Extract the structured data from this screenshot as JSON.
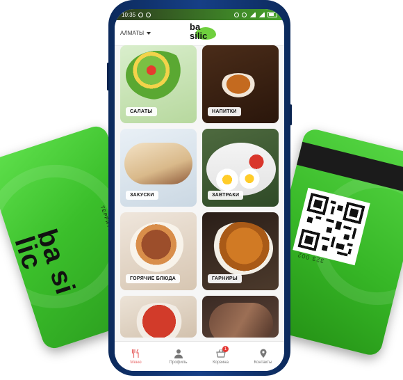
{
  "status_bar": {
    "time": "10:35"
  },
  "header": {
    "city": "АЛМАТЫ",
    "brand_top": "ba",
    "brand_bottom": "silic"
  },
  "categories": [
    {
      "label": "САЛАТЫ"
    },
    {
      "label": "НАПИТКИ"
    },
    {
      "label": "ЗАКУСКИ"
    },
    {
      "label": "ЗАВТРАКИ"
    },
    {
      "label": "ГОРЯЧИЕ БЛЮДА"
    },
    {
      "label": "ГАРНИРЫ"
    }
  ],
  "bottom_nav": {
    "items": [
      {
        "label": "Меню",
        "icon": "fork-knife-icon",
        "active": true
      },
      {
        "label": "Профиль",
        "icon": "person-icon"
      },
      {
        "label": "Корзина",
        "icon": "basket-icon",
        "badge": "1"
      },
      {
        "label": "Контакты",
        "icon": "location-pin-icon"
      }
    ]
  },
  "cards": {
    "left": {
      "logo": "ba si lic",
      "tagline": "ТЕРРИТОРИЯ ВКУСА"
    },
    "right": {
      "number": "323 002"
    }
  },
  "colors": {
    "brand_green": "#3bbf2b",
    "accent_red": "#e86a6a",
    "phone_blue": "#163f86"
  }
}
